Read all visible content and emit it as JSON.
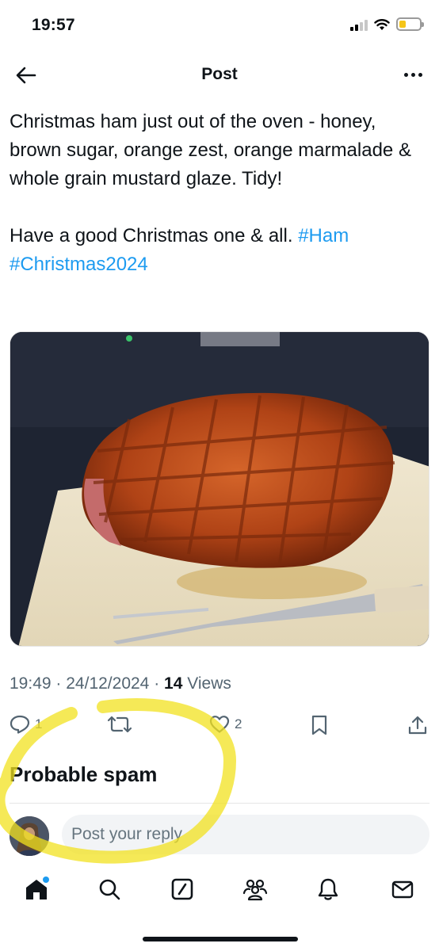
{
  "status_bar": {
    "time": "19:57",
    "battery_level": 0.35,
    "battery_color": "#f5c518"
  },
  "header": {
    "back_icon": "arrow-left-icon",
    "title": "Post",
    "more_icon": "ellipsis-icon"
  },
  "post": {
    "text_line1": "Christmas ham just out of the oven - honey, brown sugar, orange zest, orange marmalade & whole grain mustard glaze. Tidy!",
    "text_line2_prefix": "Have a good Christmas one & all. ",
    "hashtags": [
      "#Ham",
      "#Christmas2024"
    ],
    "image_alt": "Glazed Christmas ham on a cutting board with a carving fork",
    "time": "19:49",
    "date": "24/12/2024",
    "views_count": "14",
    "views_label": "Views",
    "separator": "·"
  },
  "actions": {
    "reply_count": "1",
    "repost_count": "",
    "like_count": "2"
  },
  "spam_notice": "Probable spam",
  "reply": {
    "placeholder": "Post your reply"
  },
  "tabbar": {
    "items": [
      "home-icon",
      "search-icon",
      "grok-icon",
      "communities-icon",
      "notifications-icon",
      "messages-icon"
    ]
  },
  "colors": {
    "accent": "#1d9bf0",
    "text": "#0f1419",
    "secondary": "#536471",
    "highlight": "#f2e11f"
  }
}
